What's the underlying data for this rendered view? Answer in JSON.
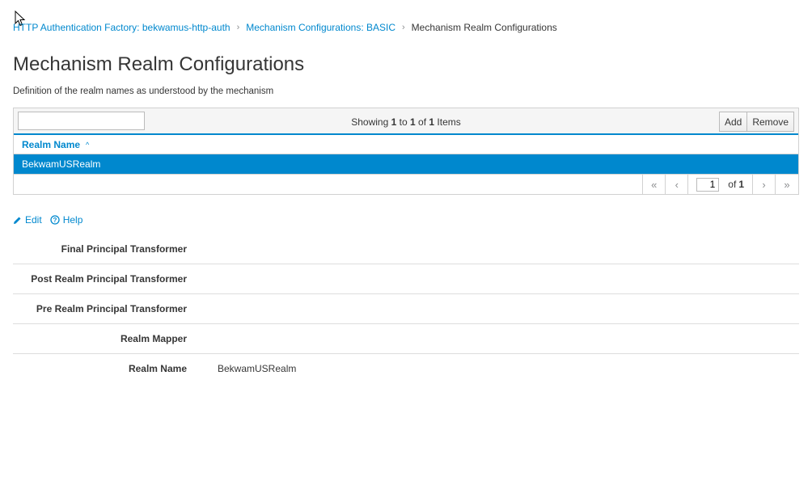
{
  "breadcrumb": {
    "items": [
      {
        "label": "HTTP Authentication Factory: bekwamus-http-auth"
      },
      {
        "label": "Mechanism Configurations: BASIC"
      }
    ],
    "current": "Mechanism Realm Configurations"
  },
  "page": {
    "title": "Mechanism Realm Configurations",
    "description": "Definition of the realm names as understood by the mechanism"
  },
  "table": {
    "filter_value": "",
    "showing": {
      "prefix": "Showing",
      "from": "1",
      "to_word": "to",
      "to": "1",
      "of_word": "of",
      "total": "1",
      "suffix": "Items"
    },
    "buttons": {
      "add": "Add",
      "remove": "Remove"
    },
    "columns": [
      {
        "label": "Realm Name",
        "sort": "ascending"
      }
    ],
    "rows": [
      {
        "realm_name": "BekwamUSRealm",
        "selected": true
      }
    ],
    "pager": {
      "page": "1",
      "of_word": "of",
      "total_pages": "1"
    }
  },
  "actions": {
    "edit": "Edit",
    "help": "Help"
  },
  "details": [
    {
      "label": "Final Principal Transformer",
      "value": ""
    },
    {
      "label": "Post Realm Principal Transformer",
      "value": ""
    },
    {
      "label": "Pre Realm Principal Transformer",
      "value": ""
    },
    {
      "label": "Realm Mapper",
      "value": ""
    },
    {
      "label": "Realm Name",
      "value": "BekwamUSRealm"
    }
  ],
  "colors": {
    "accent": "#0088ce",
    "selected_row": "#0088ce",
    "text": "#363636"
  }
}
